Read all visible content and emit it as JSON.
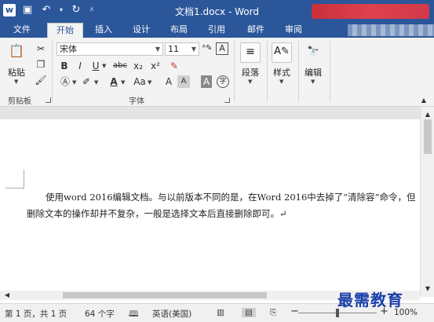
{
  "titlebar": {
    "doc_title": "文档1.docx - Word",
    "qat": {
      "app_icon": "w",
      "save_icon": "save-icon",
      "undo_icon": "undo-icon",
      "redo_icon": "redo-icon",
      "customize_icon": "customize-icon"
    }
  },
  "tabs": [
    {
      "label": "文件"
    },
    {
      "label": "开始"
    },
    {
      "label": "插入"
    },
    {
      "label": "设计"
    },
    {
      "label": "布局"
    },
    {
      "label": "引用"
    },
    {
      "label": "邮件"
    },
    {
      "label": "审阅"
    }
  ],
  "active_tab": "开始",
  "ribbon": {
    "clipboard": {
      "paste_label": "粘贴",
      "group_label": "剪贴板"
    },
    "font": {
      "font_name": "宋体",
      "font_size": "11",
      "group_label": "字体",
      "bold": "B",
      "italic": "I",
      "underline": "U",
      "strike": "abc",
      "subscript": "x₂",
      "superscript": "x²",
      "grow": "A",
      "shrink": "A",
      "change_case": "Aa",
      "char_border": "A",
      "char_shading": "A",
      "phonetic": "字"
    },
    "paragraph_label": "段落",
    "styles_label": "样式",
    "editing_label": "编辑"
  },
  "document": {
    "paragraph": "使用word 2016编辑文档。与以前版本不同的是，在Word 2016中去掉了“清除容”命令，但删除文本的操作却并不复杂，一般是选择文本后直接删除即可。↵"
  },
  "status": {
    "page": "第 1 页，共 1 页",
    "words": "64 个字",
    "language": "英语(美国)",
    "zoom": "100%",
    "zoom_minus": "−",
    "zoom_plus": "+"
  },
  "watermark": "最需教育",
  "colors": {
    "accent": "#2b579a",
    "ribbon_bg": "#f3f3f3"
  }
}
